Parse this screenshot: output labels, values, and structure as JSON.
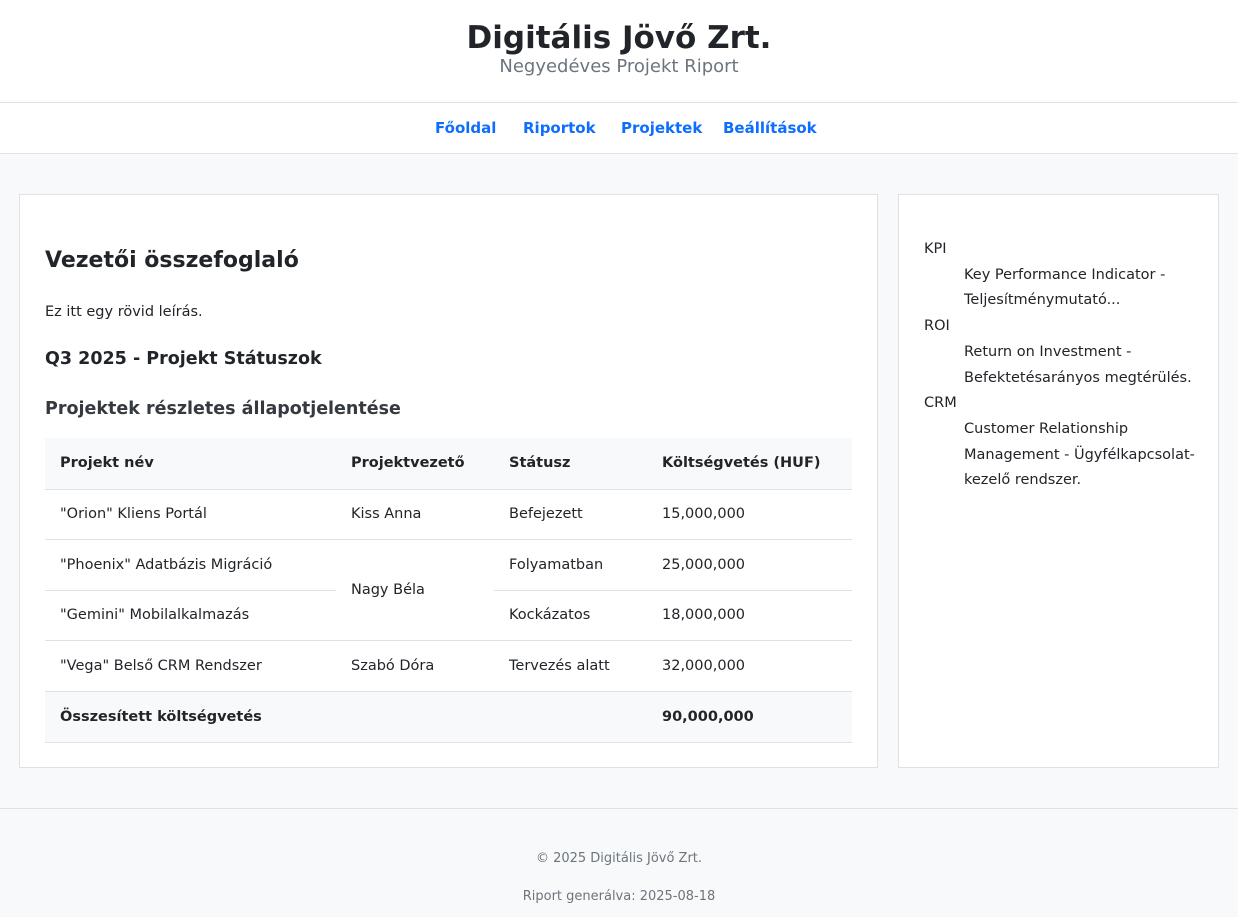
{
  "header": {
    "title": "Digitális Jövő Zrt.",
    "subtitle": "Negyedéves Projekt Riport"
  },
  "nav": {
    "items": [
      "Főoldal",
      "Riportok",
      "Projektek",
      "Beállítások"
    ]
  },
  "main": {
    "heading": "Vezetői összefoglaló",
    "description": "Ez itt egy rövid leírás.",
    "section_title": "Q3 2025 - Projekt Státuszok",
    "table_title": "Projektek részletes állapotjelentése",
    "table": {
      "headers": [
        "Projekt név",
        "Projektvezető",
        "Státusz",
        "Költségvetés (HUF)"
      ],
      "rows": [
        {
          "name": "\"Orion\" Kliens Portál",
          "lead": "Kiss Anna",
          "status": "Befejezett",
          "budget": "15,000,000"
        },
        {
          "name": "\"Phoenix\" Adatbázis Migráció",
          "lead": "Nagy Béla",
          "status": "Folyamatban",
          "budget": "25,000,000"
        },
        {
          "name": "\"Gemini\" Mobilalkalmazás",
          "status": "Kockázatos",
          "budget": "18,000,000"
        },
        {
          "name": "\"Vega\" Belső CRM Rendszer",
          "lead": "Szabó Dóra",
          "status": "Tervezés alatt",
          "budget": "32,000,000"
        }
      ],
      "footer": {
        "label": "Összesített költségvetés",
        "total": "90,000,000"
      }
    }
  },
  "glossary": [
    {
      "term": "KPI",
      "definition": "Key Performance Indicator - Teljesítménymutató..."
    },
    {
      "term": "ROI",
      "definition": "Return on Investment - Befektetésarányos megtérülés."
    },
    {
      "term": "CRM",
      "definition": "Customer Relationship Management - Ügyfélkapcsolat-kezelő rendszer."
    }
  ],
  "footer": {
    "copyright": "© 2025 Digitális Jövő Zrt.",
    "generated": "Riport generálva: 2025-08-18"
  }
}
